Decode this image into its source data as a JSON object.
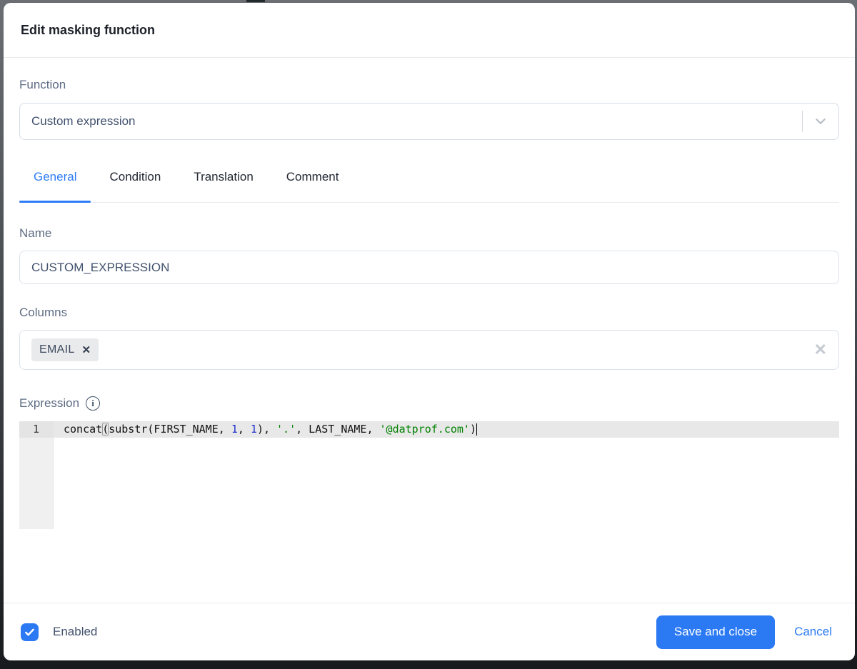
{
  "modal": {
    "title": "Edit masking function",
    "function_field": {
      "label": "Function",
      "value": "Custom expression"
    },
    "tabs": [
      {
        "label": "General",
        "active": true
      },
      {
        "label": "Condition",
        "active": false
      },
      {
        "label": "Translation",
        "active": false
      },
      {
        "label": "Comment",
        "active": false
      }
    ],
    "name_field": {
      "label": "Name",
      "value": "CUSTOM_EXPRESSION"
    },
    "columns_field": {
      "label": "Columns",
      "chips": [
        {
          "label": "EMAIL",
          "remove_icon": "✕"
        }
      ],
      "clear_icon": "✕"
    },
    "expression_field": {
      "label": "Expression",
      "info_icon": "i",
      "line_number": "1",
      "code_full": "concat(substr(FIRST_NAME, 1, 1), '.', LAST_NAME, '@datprof.com')",
      "code_tokens": [
        {
          "text": "concat",
          "type": "plain"
        },
        {
          "text": "(",
          "type": "bracket-match"
        },
        {
          "text": "substr(FIRST_NAME, ",
          "type": "plain"
        },
        {
          "text": "1",
          "type": "number"
        },
        {
          "text": ", ",
          "type": "plain"
        },
        {
          "text": "1",
          "type": "number"
        },
        {
          "text": "), ",
          "type": "plain"
        },
        {
          "text": "'.'",
          "type": "string"
        },
        {
          "text": ", LAST_NAME, ",
          "type": "plain"
        },
        {
          "text": "'@datprof.com'",
          "type": "string"
        },
        {
          "text": ")",
          "type": "plain"
        }
      ]
    },
    "footer": {
      "checkbox_checked": true,
      "enabled_label": "Enabled",
      "save_label": "Save and close",
      "cancel_label": "Cancel"
    }
  },
  "colors": {
    "accent_blue": "#2b7af3",
    "tab_active_blue": "#2e7cf6",
    "code_number": "#2233cc",
    "code_string": "#008000",
    "backdrop_dark": "#17191c"
  }
}
